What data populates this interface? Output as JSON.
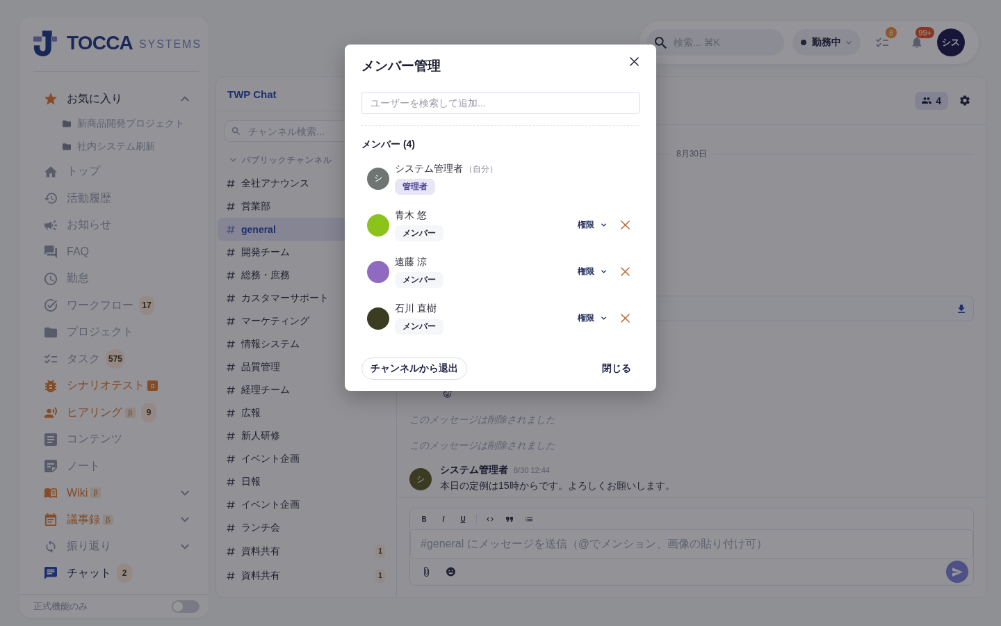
{
  "sidebar": {
    "logo": {
      "name": "TOCCA",
      "suffix": "SYSTEMS"
    },
    "items": [
      {
        "kind": "section",
        "label": "お気に入り",
        "expanded": true,
        "children": [
          {
            "label": "新商品開発プロジェクト"
          },
          {
            "label": "社内システム刷新"
          }
        ]
      },
      {
        "kind": "link",
        "label": "トップ",
        "selected": false,
        "accent": false
      },
      {
        "kind": "link",
        "label": "活動履歴",
        "selected": false,
        "accent": false
      },
      {
        "kind": "link",
        "label": "お知らせ",
        "selected": false,
        "accent": false
      },
      {
        "kind": "link",
        "label": "FAQ",
        "selected": false,
        "accent": false
      },
      {
        "kind": "link",
        "label": "勤怠",
        "selected": false,
        "accent": false
      },
      {
        "kind": "link",
        "label": "ワークフロー",
        "selected": false,
        "accent": false,
        "badge": "17"
      },
      {
        "kind": "link",
        "label": "プロジェクト",
        "selected": false,
        "accent": false
      },
      {
        "kind": "link",
        "label": "タスク",
        "selected": false,
        "accent": false,
        "badge": "575"
      },
      {
        "kind": "link",
        "label": "シナリオテスト",
        "selected": false,
        "accent": true,
        "tag": {
          "label": "α",
          "solid": true
        }
      },
      {
        "kind": "link",
        "label": "ヒアリング",
        "selected": false,
        "accent": true,
        "tag": {
          "label": "β",
          "solid": false
        },
        "badge": "9"
      },
      {
        "kind": "link",
        "label": "コンテンツ",
        "selected": false,
        "accent": false
      },
      {
        "kind": "link",
        "label": "ノート",
        "selected": false,
        "accent": false
      },
      {
        "kind": "link",
        "label": "Wiki",
        "selected": false,
        "accent": true,
        "tag": {
          "label": "β",
          "solid": false
        },
        "expanded": false
      },
      {
        "kind": "link",
        "label": "議事録",
        "selected": false,
        "accent": true,
        "tag": {
          "label": "β",
          "solid": false
        },
        "expanded": false
      },
      {
        "kind": "link",
        "label": "振り返り",
        "selected": false,
        "accent": false,
        "expanded": false
      },
      {
        "kind": "link",
        "label": "チャット",
        "selected": true,
        "accent": false,
        "badge": "2"
      }
    ],
    "footer": {
      "label": "正式機能のみ",
      "on": false
    }
  },
  "topbar": {
    "search": {
      "placeholder": "検索... ⌘K"
    },
    "status": "勤務中",
    "tasks_badge": "8",
    "notifications_badge": "99+",
    "avatar": "シス"
  },
  "channels": {
    "title": "TWP Chat",
    "search": {
      "placeholder": "チャンネル検索..."
    },
    "section": {
      "label": "パブリックチャンネル",
      "expanded": true
    },
    "items": [
      {
        "name": "全社アナウンス",
        "selected": false
      },
      {
        "name": "営業部",
        "selected": false
      },
      {
        "name": "general",
        "selected": true
      },
      {
        "name": "開発チーム",
        "selected": false
      },
      {
        "name": "総務・庶務",
        "selected": false
      },
      {
        "name": "カスタマーサポート",
        "selected": false
      },
      {
        "name": "マーケティング",
        "selected": false
      },
      {
        "name": "情報システム",
        "selected": false
      },
      {
        "name": "品質管理",
        "selected": false
      },
      {
        "name": "経理チーム",
        "selected": false
      },
      {
        "name": "広報",
        "selected": false
      },
      {
        "name": "新人研修",
        "selected": false
      },
      {
        "name": "イベント企画",
        "selected": false
      },
      {
        "name": "日報",
        "selected": false
      },
      {
        "name": "イベント企画",
        "selected": false
      },
      {
        "name": "ランチ会",
        "selected": false
      },
      {
        "name": "資料共有",
        "selected": false,
        "badge": "1"
      },
      {
        "name": "資料共有",
        "selected": false,
        "badge": "1"
      }
    ]
  },
  "chat": {
    "members_count": "4",
    "date": "8月30日",
    "messages": [
      {
        "kind": "deleted",
        "text": "このメッセージは削除されました"
      },
      {
        "kind": "deleted",
        "text": "このメッセージは削除されました"
      },
      {
        "kind": "message",
        "initial": "シ",
        "author": "システム管理者",
        "time": "8/30 12:44",
        "text": "本日の定例は15時からです。よろしくお願いします。"
      }
    ],
    "composer": {
      "toolbar": [
        {
          "kind": "bold",
          "label": "B"
        },
        {
          "kind": "italic",
          "label": "I"
        },
        {
          "kind": "underline",
          "label": "U"
        },
        {
          "kind": "code"
        },
        {
          "kind": "quote"
        },
        {
          "kind": "list"
        }
      ],
      "placeholder": "#general にメッセージを送信（@でメンション、画像の貼り付け可）"
    }
  },
  "modal": {
    "title": "メンバー管理",
    "search": {
      "placeholder": "ユーザーを検索して追加..."
    },
    "heading": "メンバー (4)",
    "members": [
      {
        "name": "システム管理者",
        "note": "（自分）",
        "initial": "シ",
        "color": "#6e7572",
        "role": {
          "label": "管理者",
          "kind": "admin"
        },
        "removable": false
      },
      {
        "name": "青木 悠",
        "color": "#8cc31a",
        "role": {
          "label": "メンバー",
          "kind": "member"
        },
        "permission": "権限",
        "removable": true
      },
      {
        "name": "遠藤 涼",
        "color": "#8e6ac0",
        "role": {
          "label": "メンバー",
          "kind": "member"
        },
        "permission": "権限",
        "removable": true
      },
      {
        "name": "石川 直樹",
        "color": "#3a3d22",
        "role": {
          "label": "メンバー",
          "kind": "member"
        },
        "permission": "権限",
        "removable": true
      }
    ],
    "leave_button": "チャンネルから退出",
    "close_button": "閉じる"
  }
}
